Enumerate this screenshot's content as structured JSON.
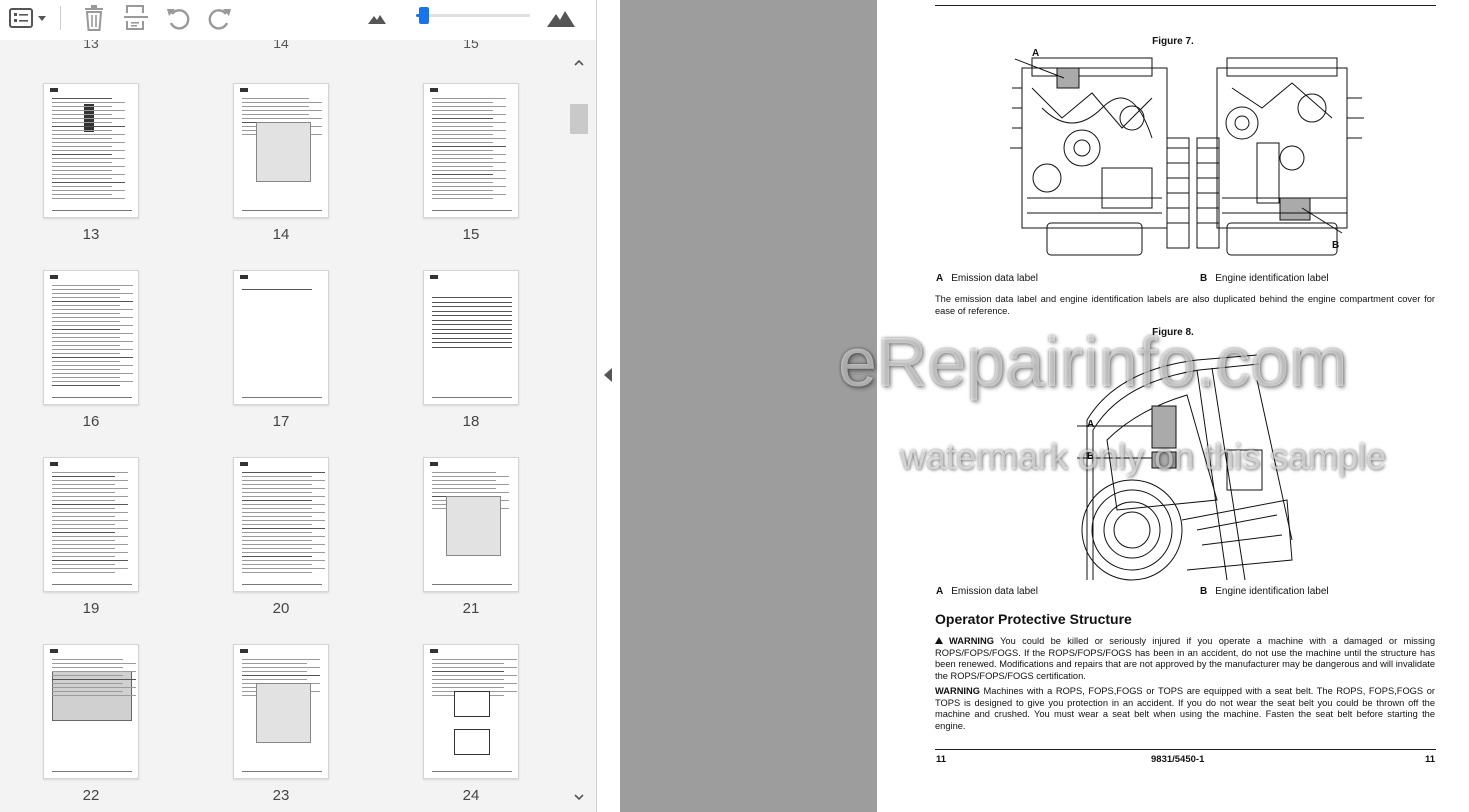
{
  "toolbar": {
    "buttons": [
      "thumbnail-view-icon",
      "delete-icon",
      "extract-pages-icon",
      "undo-icon",
      "redo-icon",
      "zoom-out-icon",
      "zoom-in-icon"
    ],
    "zoom_level": 0.05
  },
  "thumbnails": {
    "partial_top_labels": [
      "13",
      "14",
      "15"
    ],
    "rows": [
      [
        "13",
        "14",
        "15"
      ],
      [
        "16",
        "17",
        "18"
      ],
      [
        "19",
        "20",
        "21"
      ],
      [
        "22",
        "23",
        "24"
      ]
    ]
  },
  "document": {
    "figure7_title": "Figure 7.",
    "figure7_callouts": [
      "A",
      "B"
    ],
    "figure7_legend_a_letter": "A",
    "figure7_legend_a_text": "Emission data label",
    "figure7_legend_b_letter": "B",
    "figure7_legend_b_text": "Engine identification label",
    "paragraph1": "The emission data label and engine identification labels are also duplicated behind the engine compartment cover for ease of reference.",
    "figure8_title": "Figure 8.",
    "figure8_callouts": [
      "A",
      "B"
    ],
    "figure8_legend_a_letter": "A",
    "figure8_legend_a_text": "Emission data label",
    "figure8_legend_b_letter": "B",
    "figure8_legend_b_text": "Engine identification label",
    "section_heading": "Operator Protective Structure",
    "warning1_label": "WARNING",
    "warning1_text": "You could be killed or seriously injured if you operate a machine with a damaged or missing ROPS/FOPS/FOGS. If the ROPS/FOPS/FOGS has been in an accident, do not use the machine until the structure has been renewed. Modifications and repairs that are not approved by the manufacturer may be dangerous and will invalidate the ROPS/FOPS/FOGS certification.",
    "warning2_label": "WARNING",
    "warning2_text": "Machines with a ROPS, FOPS,FOGS or TOPS are equipped with a seat belt. The ROPS, FOPS,FOGS or TOPS is designed to give you protection in an accident. If you do not wear the seat belt you could be thrown off the machine and crushed. You must wear a seat belt when using the machine. Fasten the seat belt before starting the engine.",
    "footer_left": "11",
    "footer_center": "9831/5450-1",
    "footer_right": "11"
  },
  "watermark": {
    "line1": "eRepairinfo.com",
    "line2": "watermark only on this sample"
  }
}
